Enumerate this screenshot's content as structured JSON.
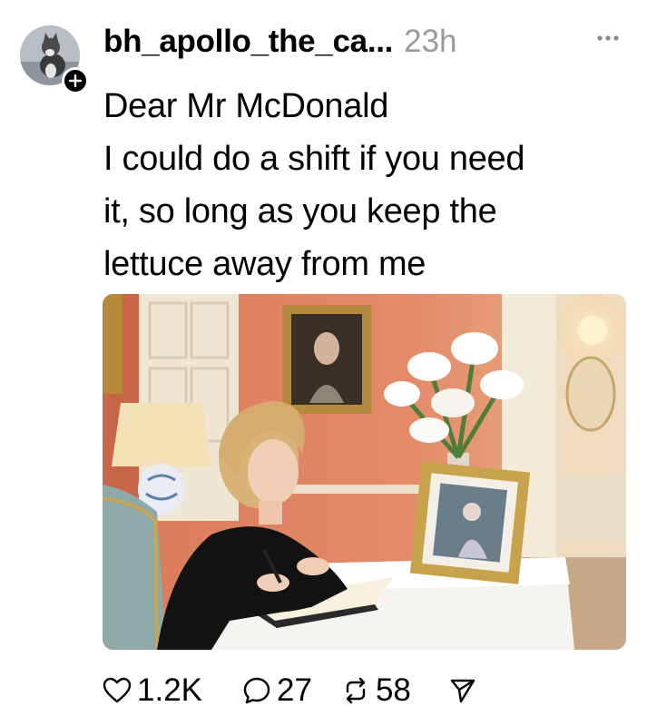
{
  "post": {
    "username": "bh_apollo_the_ca...",
    "timestamp": "23h",
    "text_lines": [
      "Dear Mr McDonald",
      "I could do a shift if you need",
      "it, so long as you keep the",
      "lettuce away from me"
    ],
    "icons": {
      "avatar": "cat-avatar",
      "follow": "plus-icon",
      "more": "more-options-icon",
      "image": "photo-woman-signing-book"
    }
  },
  "actions": {
    "likes": "1.2K",
    "replies": "27",
    "reposts": "58",
    "icons": [
      "heart-icon",
      "comment-icon",
      "repost-icon",
      "send-icon"
    ]
  },
  "colors": {
    "text": "#000000",
    "muted": "#9a9a9a",
    "background": "#ffffff"
  }
}
